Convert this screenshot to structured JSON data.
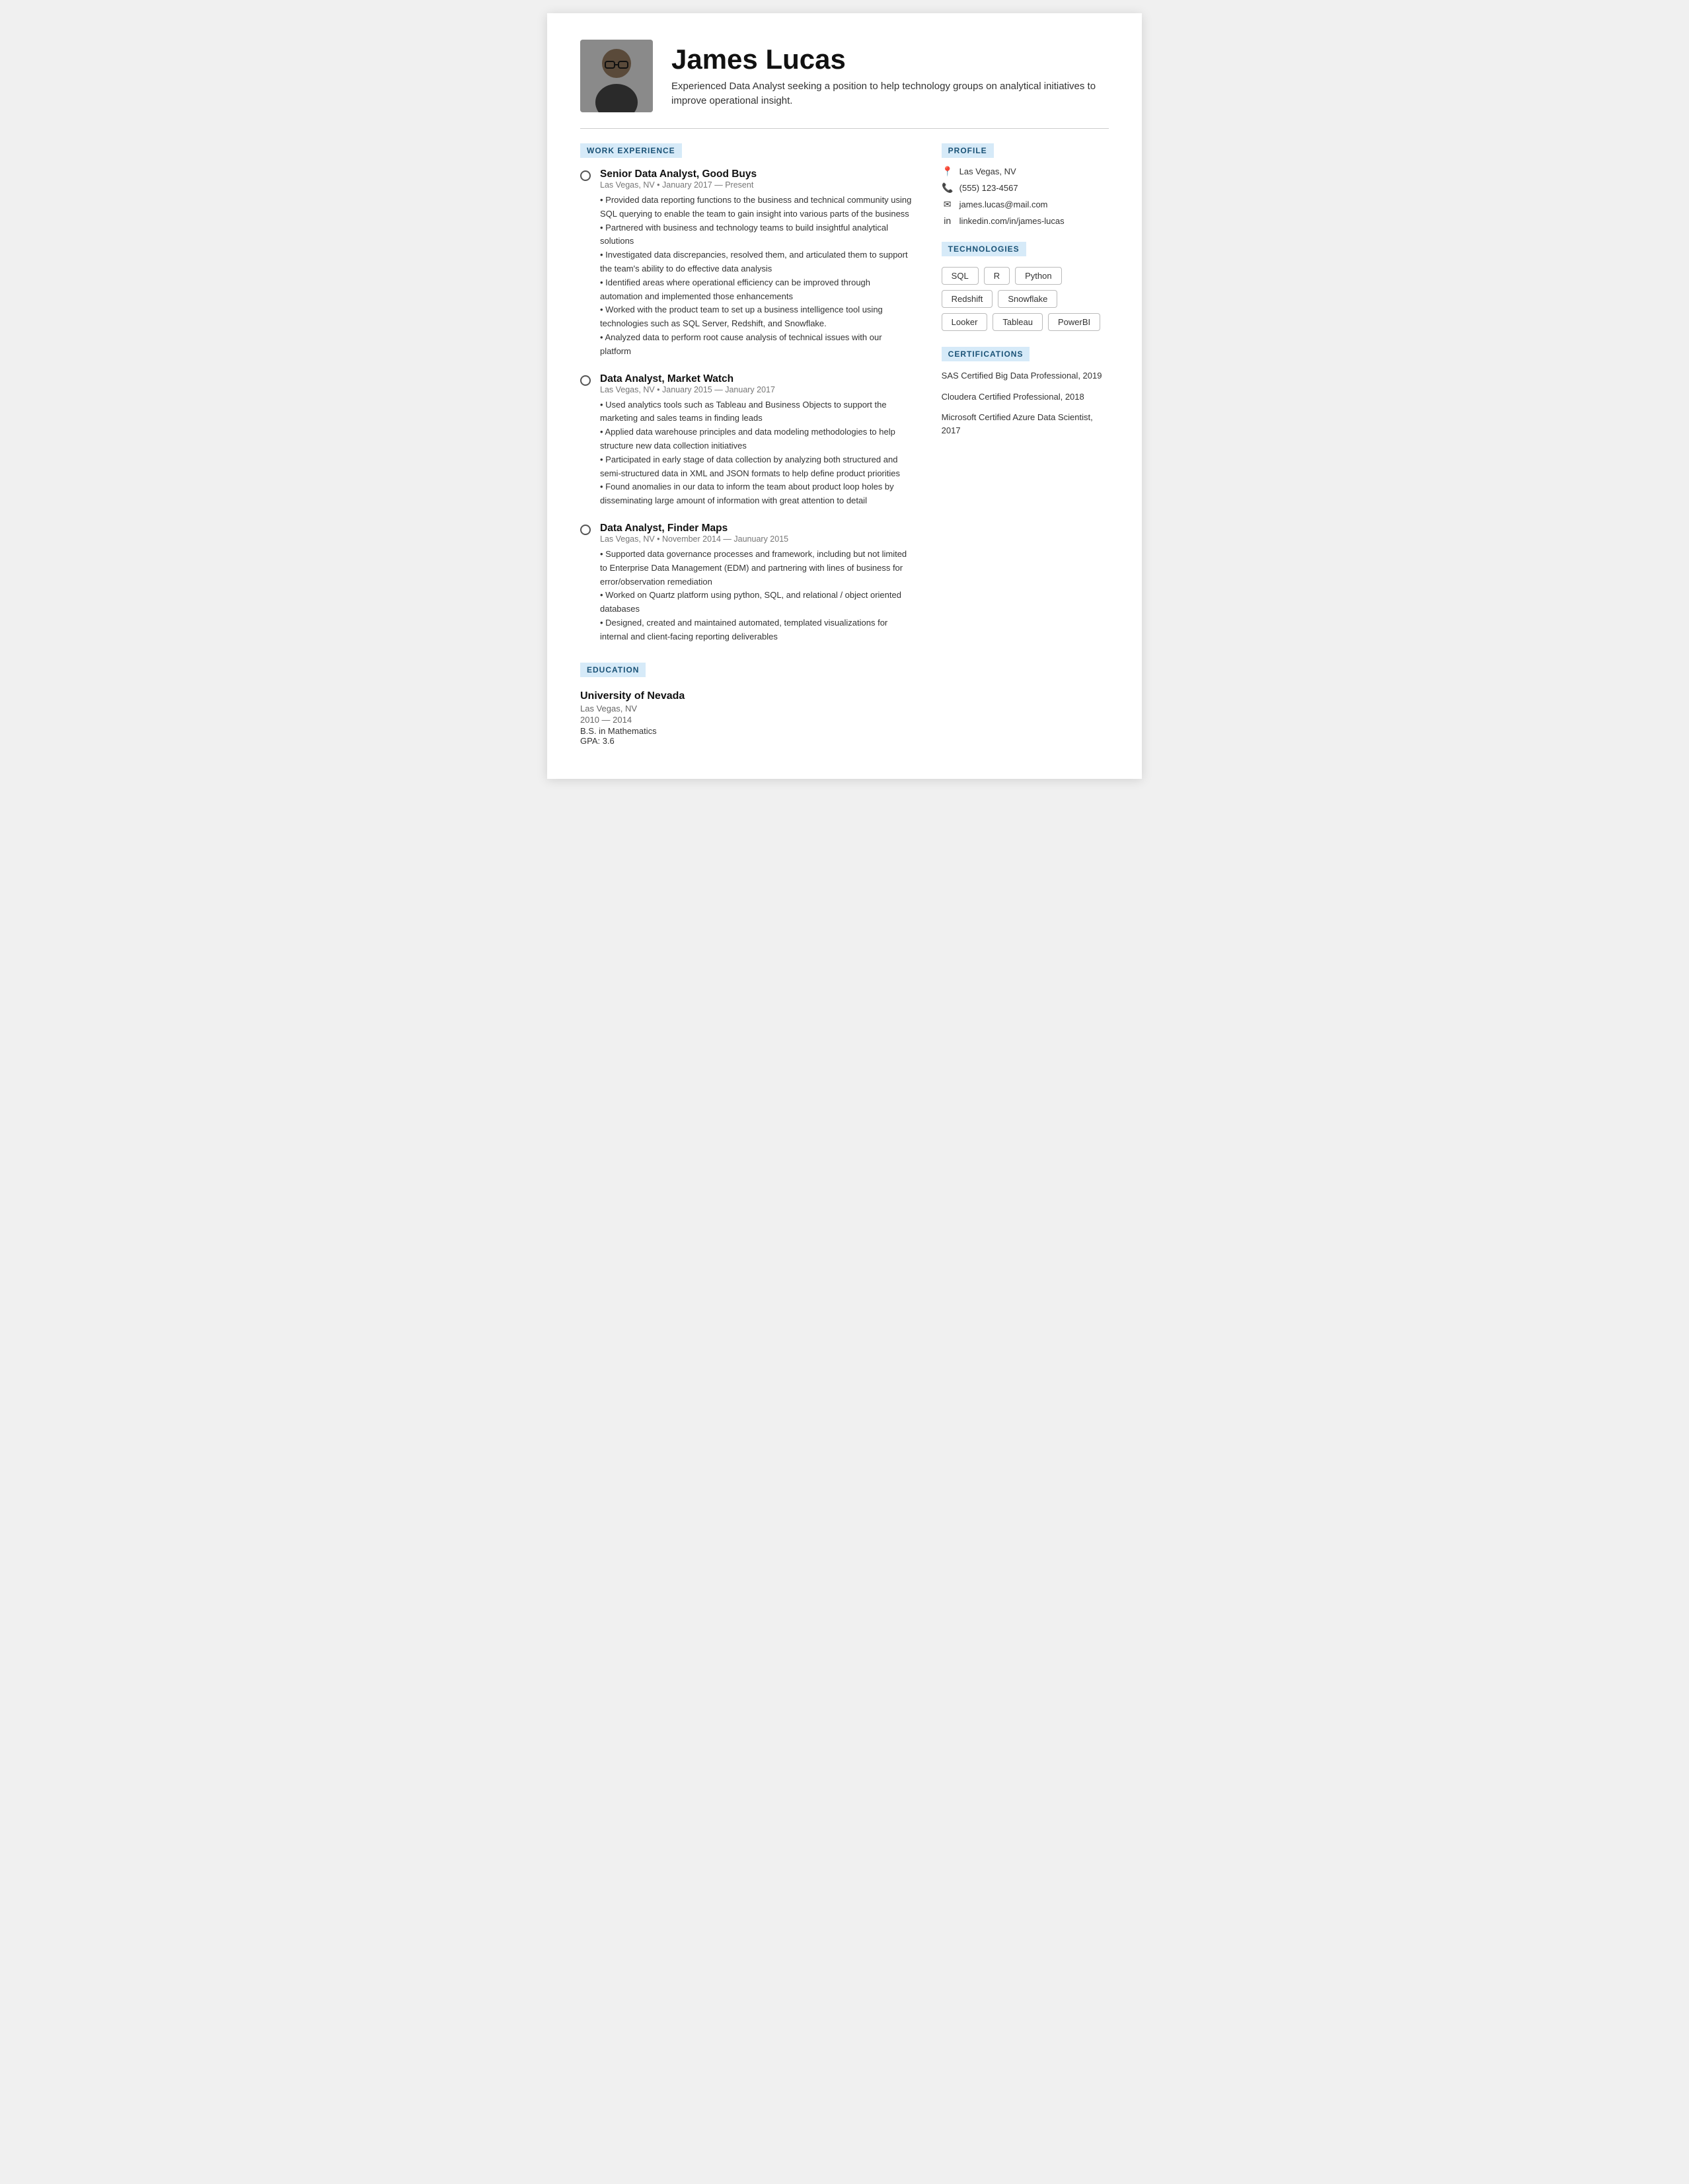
{
  "header": {
    "name": "James Lucas",
    "tagline": "Experienced Data Analyst seeking a position to help technology groups on analytical initiatives to improve operational insight."
  },
  "sections": {
    "work_experience_label": "WORK EXPERIENCE",
    "education_label": "EDUCATION",
    "profile_label": "PROFILE",
    "technologies_label": "TECHNOLOGIES",
    "certifications_label": "CERTIFICATIONS"
  },
  "jobs": [
    {
      "title": "Senior Data Analyst, Good Buys",
      "meta": "Las Vegas, NV • January 2017 — Present",
      "bullets": [
        "• Provided data reporting functions to the business and technical community using SQL querying to enable the team to gain insight into various parts of the business",
        "• Partnered with business and technology teams to build insightful analytical solutions",
        "• Investigated data discrepancies, resolved them, and articulated them to support the team's ability to do effective data analysis",
        "• Identified areas where operational efficiency can be improved through automation and implemented those enhancements",
        "• Worked with the product team to set up a business intelligence tool using technologies such as SQL Server, Redshift, and Snowflake.",
        "• Analyzed data to perform root cause analysis of technical issues with our platform"
      ]
    },
    {
      "title": "Data Analyst, Market Watch",
      "meta": "Las Vegas, NV • January 2015 — January 2017",
      "bullets": [
        "• Used analytics tools such as Tableau and Business Objects to support the marketing and sales teams in finding leads",
        "• Applied data warehouse principles and data modeling methodologies to help structure new data collection initiatives",
        "• Participated in early stage of data collection by analyzing both structured and semi-structured data in XML and JSON formats to help define product priorities",
        "• Found anomalies in our data to inform the team about product loop holes by disseminating large amount of information with great attention to detail"
      ]
    },
    {
      "title": "Data Analyst, Finder Maps",
      "meta": "Las Vegas, NV • November 2014 — Jaunuary 2015",
      "bullets": [
        "• Supported data governance processes and framework, including but not limited to Enterprise Data Management (EDM) and partnering with lines of business for error/observation remediation",
        "• Worked on Quartz platform using python, SQL, and relational / object oriented databases",
        "• Designed, created and maintained automated, templated visualizations for internal and client-facing reporting deliverables"
      ]
    }
  ],
  "education": {
    "school": "University of Nevada",
    "location": "Las Vegas, NV",
    "years": "2010 — 2014",
    "degree": "B.S. in Mathematics",
    "gpa": "GPA: 3.6"
  },
  "profile": {
    "location": "Las Vegas, NV",
    "phone": "(555) 123-4567",
    "email": "james.lucas@mail.com",
    "linkedin": "linkedin.com/in/james-lucas"
  },
  "technologies": [
    "SQL",
    "R",
    "Python",
    "Redshift",
    "Snowflake",
    "Looker",
    "Tableau",
    "PowerBI"
  ],
  "certifications": [
    "SAS Certified Big Data Professional, 2019",
    "Cloudera Certified Professional, 2018",
    "Microsoft Certified Azure Data Scientist, 2017"
  ]
}
